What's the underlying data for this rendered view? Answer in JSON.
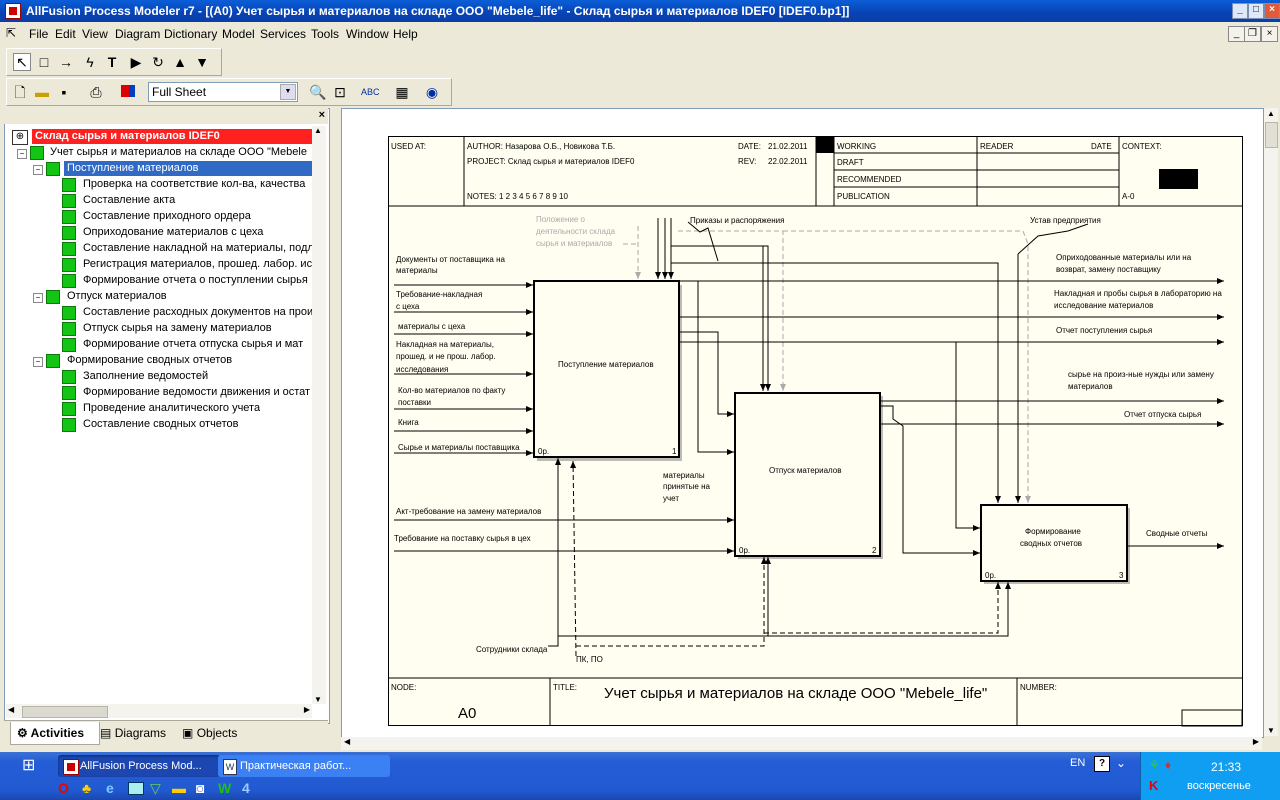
{
  "window": {
    "title": "AllFusion Process Modeler r7 - [(A0) Учет сырья и материалов  на складе ООО \"Mebele_life\"  - Склад сырья и материалов IDEF0  [IDEF0.bp1]]"
  },
  "menu": {
    "items": [
      "File",
      "Edit",
      "View",
      "Diagram",
      "Dictionary",
      "Model",
      "Services",
      "Tools",
      "Window",
      "Help"
    ]
  },
  "toolbar": {
    "zoom_value": "Full Sheet"
  },
  "tree": {
    "root": "Склад сырья и материалов IDEF0",
    "top": "Учет сырья и материалов  на складе ООО \"Mebele",
    "groups": [
      {
        "label": "Поступление материалов",
        "children": [
          "Проверка на соответствие кол-ва,  качества",
          "Составление акта",
          "Составление  приходного ордера",
          "Оприходование  материалов с цеха",
          "Составление накладной на материалы,  подл",
          "Регистрация материалов,  прошед. лабор. ис",
          "Формирование отчета  о поступлении сырья"
        ]
      },
      {
        "label": "Отпуск материалов",
        "children": [
          "Составление расходных документов  на прои",
          "Отпуск сырья на  замену материалов",
          "Формирование отчета отпуска  сырья и мат"
        ]
      },
      {
        "label": "Формирование сводных отчетов",
        "children": [
          "Заполнение ведомостей",
          "Формирование ведомости движения и остат",
          "Проведение  аналитического учета",
          "Составление  сводных отчетов"
        ]
      }
    ]
  },
  "tabs": [
    "Activities",
    "Diagrams",
    "Objects"
  ],
  "diagram": {
    "header": {
      "used_at": "USED AT:",
      "author": "AUTHOR: Назарова О.Б., Новикова Т.Б.",
      "project": "PROJECT:  Склад сырья и материалов IDEF0",
      "notes": "NOTES:  1  2  3  4  5  6  7  8  9  10",
      "date_label": "DATE:",
      "date": "21.02.2011",
      "rev_label": "REV:",
      "rev": "22.02.2011",
      "status": [
        "WORKING",
        "DRAFT",
        "RECOMMENDED",
        "PUBLICATION"
      ],
      "reader": "READER",
      "reader_date": "DATE",
      "context": "CONTEXT:",
      "context_node": "A-0"
    },
    "footer": {
      "node_label": "NODE:",
      "node": "A0",
      "title_label": "TITLE:",
      "title": "Учет сырья и материалов  на складе ООО \"Mebele_life\"",
      "number_label": "NUMBER:"
    },
    "boxes": [
      {
        "label": "Поступление материалов",
        "num": "1",
        "cost": "0р."
      },
      {
        "label": "Отпуск материалов",
        "num": "2",
        "cost": "0р."
      },
      {
        "label1": "Формирование",
        "label2": "сводных отчетов",
        "num": "3",
        "cost": "0р."
      }
    ],
    "inputs": [
      [
        "Документы от поставщика на",
        "материалы"
      ],
      [
        "Требование-накладная",
        "с цеха"
      ],
      [
        "материалы с цеха"
      ],
      [
        "Накладная на материалы,",
        "прошед. и не прош. лабор.",
        "исследования"
      ],
      [
        "Кол-во материалов по  факту",
        "поставки"
      ],
      [
        "Книга"
      ],
      [
        "Сырье и материалы поставщика"
      ]
    ],
    "controls": {
      "position": [
        "Положение о",
        "деятельности склада",
        "сырья и материалов"
      ],
      "orders": "Приказы и распоряжения",
      "charter": "Устав предприятия"
    },
    "outputs": [
      [
        "Оприходованные материалы или на",
        "возврат, замену поставщику"
      ],
      [
        "Накладная и пробы сырья в лабораторию на",
        "исследование материалов"
      ],
      [
        "Отчет поступления сырья"
      ],
      [
        "сырье на произ-ные нужды или замену",
        "материалов"
      ],
      [
        "Отчет отпуска сырья"
      ],
      [
        "Сводные отчеты"
      ]
    ],
    "inputs2": [
      "Акт-требование на замену материалов",
      "Требование на поставку сырья в цех"
    ],
    "intermediate": [
      "материалы",
      "принятые на",
      "учет"
    ],
    "mechanisms": {
      "staff": "Сотрудники склада",
      "pc": "ПК, ПО"
    }
  },
  "taskbar": {
    "tasks": [
      "AllFusion Process Mod...",
      "Практическая работ..."
    ],
    "lang": "EN",
    "time": "21:33",
    "day": "воскресенье"
  }
}
